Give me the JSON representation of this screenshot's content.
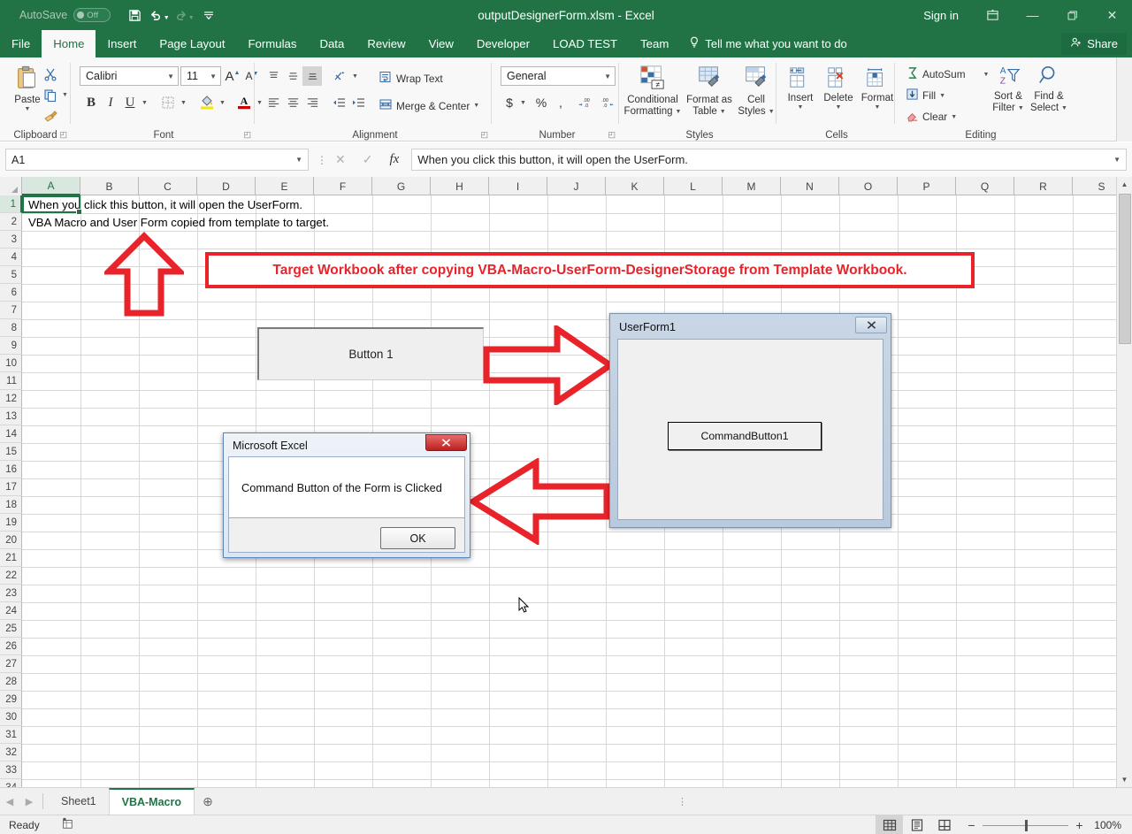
{
  "titlebar": {
    "autosave_label": "AutoSave",
    "autosave_state": "Off",
    "document_title": "outputDesignerForm.xlsm  -  Excel",
    "signin": "Sign in",
    "qat": [
      {
        "name": "save-icon",
        "glyph": "💾"
      },
      {
        "name": "undo-icon",
        "glyph": "↶"
      },
      {
        "name": "redo-icon",
        "glyph": "↷"
      },
      {
        "name": "customize-qat-icon",
        "glyph": "⨍"
      }
    ],
    "ribbon_display_options": "⬜",
    "minimize": "—",
    "restore": "❐",
    "close": "✕"
  },
  "tabs": [
    {
      "label": "File",
      "active": false
    },
    {
      "label": "Home",
      "active": true
    },
    {
      "label": "Insert",
      "active": false
    },
    {
      "label": "Page Layout",
      "active": false
    },
    {
      "label": "Formulas",
      "active": false
    },
    {
      "label": "Data",
      "active": false
    },
    {
      "label": "Review",
      "active": false
    },
    {
      "label": "View",
      "active": false
    },
    {
      "label": "Developer",
      "active": false
    },
    {
      "label": "LOAD TEST",
      "active": false
    },
    {
      "label": "Team",
      "active": false
    }
  ],
  "tellme": "Tell me what you want to do",
  "share_label": "Share",
  "ribbon": {
    "clipboard": {
      "label": "Clipboard",
      "paste": "Paste",
      "cut": "Cut",
      "copy": "Copy",
      "format_painter": "Format Painter"
    },
    "font": {
      "label": "Font",
      "font_name": "Calibri",
      "font_size": "11",
      "grow_font": "A",
      "shrink_font": "A",
      "bold": "B",
      "italic": "I",
      "underline": "U",
      "borders": "▦",
      "fill_color": "◆",
      "font_color": "A"
    },
    "alignment": {
      "label": "Alignment",
      "wrap_text": "Wrap Text",
      "merge_center": "Merge & Center",
      "align_top": "≡",
      "align_middle": "≡",
      "align_bottom": "≡",
      "orientation": "⤨",
      "align_left": "≡",
      "align_center": "≡",
      "align_right": "≡",
      "decrease_indent": "←",
      "increase_indent": "→"
    },
    "number": {
      "label": "Number",
      "format": "General",
      "accounting": "$",
      "percent": "%",
      "comma": ",",
      "increase_decimal": ".00",
      "decrease_decimal": ".0"
    },
    "styles": {
      "label": "Styles",
      "conditional_formatting": "Conditional\nFormatting",
      "conditional_formatting_l1": "Conditional",
      "conditional_formatting_l2": "Formatting",
      "format_as_table_l1": "Format as",
      "format_as_table_l2": "Table",
      "cell_styles_l1": "Cell",
      "cell_styles_l2": "Styles"
    },
    "cells": {
      "label": "Cells",
      "insert": "Insert",
      "delete": "Delete",
      "format": "Format"
    },
    "editing": {
      "label": "Editing",
      "autosum": "AutoSum",
      "fill": "Fill",
      "clear": "Clear",
      "sort_filter_l1": "Sort &",
      "sort_filter_l2": "Filter",
      "find_select_l1": "Find &",
      "find_select_l2": "Select"
    }
  },
  "formulabar": {
    "name_box": "A1",
    "cancel": "✕",
    "enter": "✓",
    "insert_function": "fx",
    "formula_value": "When you click this button, it will open the UserForm."
  },
  "grid": {
    "columns": [
      "A",
      "B",
      "C",
      "D",
      "E",
      "F",
      "G",
      "H",
      "I",
      "J",
      "K",
      "L",
      "M",
      "N",
      "O",
      "P",
      "Q",
      "R",
      "S"
    ],
    "rows": [
      1,
      2,
      3,
      4,
      5,
      6,
      7,
      8,
      9,
      10,
      11,
      12,
      13,
      14,
      15,
      16,
      17,
      18,
      19,
      20,
      21,
      22,
      23,
      24,
      25,
      26,
      27,
      28,
      29,
      30,
      31,
      32,
      33,
      34
    ],
    "active_cell": "A1",
    "cells": [
      {
        "ref": "A1",
        "value": "When you click this button, it will open the UserForm."
      },
      {
        "ref": "A2",
        "value": "VBA Macro and User Form copied from template to target."
      }
    ]
  },
  "annotations": {
    "callout_text": "Target Workbook after copying VBA-Macro-UserForm-DesignerStorage from Template Workbook.",
    "callout_color": "#e8232a",
    "arrow_up": "arrow-up-to-cell-a2",
    "arrow_right": "arrow-right-to-userform",
    "arrow_left": "arrow-left-to-messagebox"
  },
  "form_button": {
    "label": "Button 1"
  },
  "userform": {
    "title": "UserForm1",
    "close_label": "✕",
    "command_button": "CommandButton1"
  },
  "msgbox": {
    "title": "Microsoft Excel",
    "close_label": "✕",
    "message": "Command Button of the Form is Clicked",
    "ok_label": "OK"
  },
  "sheetbar": {
    "nav_first": "◀",
    "nav_last": "▶",
    "sheets": [
      {
        "label": "Sheet1",
        "active": false
      },
      {
        "label": "VBA-Macro",
        "active": true
      }
    ],
    "add_sheet": "⊕"
  },
  "statusbar": {
    "status": "Ready",
    "macro_record": "▤",
    "views": [
      {
        "name": "normal-view",
        "glyph": "▦",
        "selected": true
      },
      {
        "name": "page-layout-view",
        "glyph": "▤",
        "selected": false
      },
      {
        "name": "page-break-preview",
        "glyph": "▥",
        "selected": false
      }
    ],
    "zoom_out": "−",
    "zoom_in": "+",
    "zoom_level": "100%"
  }
}
